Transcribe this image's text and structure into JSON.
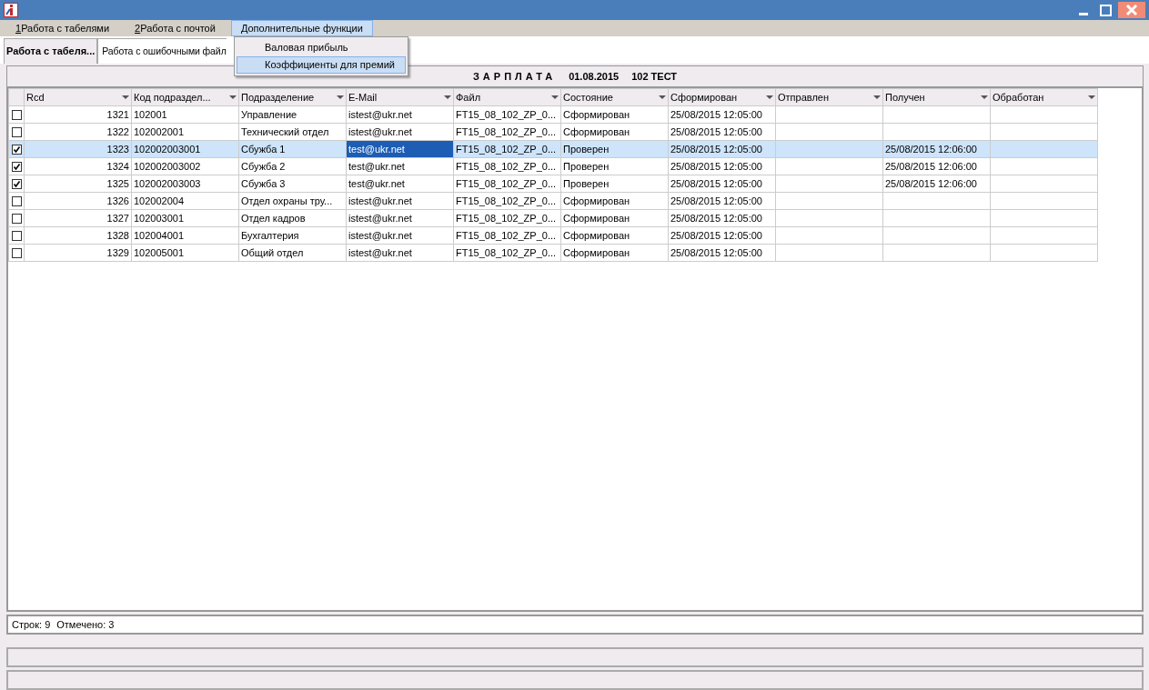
{
  "menu": [
    {
      "key": "1",
      "label": "Работа с табелями",
      "open": false
    },
    {
      "key": "2",
      "label": "Работа с почтой",
      "open": false
    },
    {
      "label": "Дополнительные функции",
      "open": true,
      "items": [
        {
          "label": "Валовая прибыль",
          "selected": false
        },
        {
          "label": "Коэффициенты для премий",
          "selected": true
        }
      ]
    }
  ],
  "tabs": [
    {
      "label": "Работа с табеля...",
      "selected": true
    },
    {
      "label": "Работа с ошибочными файл",
      "selected": false
    }
  ],
  "report_header": {
    "title": "ЗАРПЛАТА",
    "date": "01.08.2015",
    "unit": "102 ТЕСТ"
  },
  "table": {
    "columns": [
      "Rcd",
      "Код подраздел...",
      "Подразделение",
      "E-Mail",
      "Файл",
      "Состояние",
      "Сформирован",
      "Отправлен",
      "Получен",
      "Обработан"
    ],
    "rows": [
      {
        "checked": false,
        "selected": false,
        "cells": [
          "1321",
          "102001",
          "Управление",
          "istest@ukr.net",
          "FT15_08_102_ZP_0...",
          "Сформирован",
          "25/08/2015 12:05:00",
          "",
          "",
          ""
        ]
      },
      {
        "checked": false,
        "selected": false,
        "cells": [
          "1322",
          "102002001",
          "Технический отдел",
          "istest@ukr.net",
          "FT15_08_102_ZP_0...",
          "Сформирован",
          "25/08/2015 12:05:00",
          "",
          "",
          ""
        ]
      },
      {
        "checked": true,
        "selected": true,
        "cells": [
          "1323",
          "102002003001",
          "Сбужба 1",
          {
            "text": "test@ukr.net",
            "focused": true
          },
          "FT15_08_102_ZP_0...",
          "Проверен",
          "25/08/2015 12:05:00",
          "",
          "25/08/2015 12:06:00",
          ""
        ]
      },
      {
        "checked": true,
        "selected": false,
        "cells": [
          "1324",
          "102002003002",
          "Сбужба 2",
          "test@ukr.net",
          "FT15_08_102_ZP_0...",
          "Проверен",
          "25/08/2015 12:05:00",
          "",
          "25/08/2015 12:06:00",
          ""
        ]
      },
      {
        "checked": true,
        "selected": false,
        "cells": [
          "1325",
          "102002003003",
          "Сбужба 3",
          "test@ukr.net",
          "FT15_08_102_ZP_0...",
          "Проверен",
          "25/08/2015 12:05:00",
          "",
          "25/08/2015 12:06:00",
          ""
        ]
      },
      {
        "checked": false,
        "selected": false,
        "cells": [
          "1326",
          "102002004",
          "Отдел охраны тру...",
          "istest@ukr.net",
          "FT15_08_102_ZP_0...",
          "Сформирован",
          "25/08/2015 12:05:00",
          "",
          "",
          ""
        ]
      },
      {
        "checked": false,
        "selected": false,
        "cells": [
          "1327",
          "102003001",
          "Отдел кадров",
          "istest@ukr.net",
          "FT15_08_102_ZP_0...",
          "Сформирован",
          "25/08/2015 12:05:00",
          "",
          "",
          ""
        ]
      },
      {
        "checked": false,
        "selected": false,
        "cells": [
          "1328",
          "102004001",
          "Бухгалтерия",
          "istest@ukr.net",
          "FT15_08_102_ZP_0...",
          "Сформирован",
          "25/08/2015 12:05:00",
          "",
          "",
          ""
        ]
      },
      {
        "checked": false,
        "selected": false,
        "cells": [
          "1329",
          "102005001",
          "Общий отдел",
          "istest@ukr.net",
          "FT15_08_102_ZP_0...",
          "Сформирован",
          "25/08/2015 12:05:00",
          "",
          "",
          ""
        ]
      }
    ]
  },
  "status": {
    "rows": "Строк: 9",
    "marked": "Отмечено: 3"
  }
}
